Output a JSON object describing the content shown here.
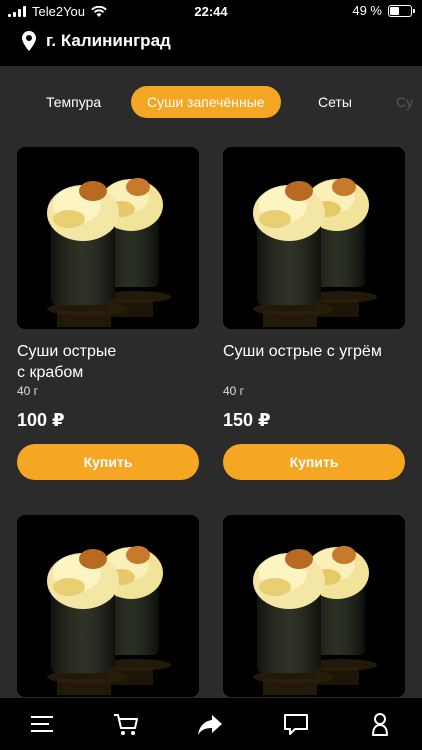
{
  "status_bar": {
    "carrier": "Tele2You",
    "time": "22:44",
    "battery": "49 %",
    "battery_level": 0.49
  },
  "header": {
    "city": "г. Калининград"
  },
  "tabs": [
    {
      "label": "Темпура",
      "active": false
    },
    {
      "label": "Суши запечённые",
      "active": true
    },
    {
      "label": "Сеты",
      "active": false
    },
    {
      "label": "Су",
      "active": false
    }
  ],
  "products": [
    {
      "title_line1": "Суши острые",
      "title_line2": "с крабом",
      "weight": "40 г",
      "price": "100 ₽",
      "buy_label": "Купить"
    },
    {
      "title_line1": "Суши острые с угрём",
      "title_line2": "",
      "weight": "40 г",
      "price": "150 ₽",
      "buy_label": "Купить"
    },
    {
      "title_line1": "",
      "title_line2": "",
      "weight": "",
      "price": "",
      "buy_label": ""
    },
    {
      "title_line1": "",
      "title_line2": "",
      "weight": "",
      "price": "",
      "buy_label": ""
    }
  ],
  "bottom_nav": [
    {
      "icon": "menu-icon"
    },
    {
      "icon": "cart-icon"
    },
    {
      "icon": "share-icon"
    },
    {
      "icon": "chat-icon"
    },
    {
      "icon": "profile-icon"
    }
  ],
  "colors": {
    "accent": "#f5a623",
    "background": "#2b2b2b",
    "bar": "#000000"
  }
}
